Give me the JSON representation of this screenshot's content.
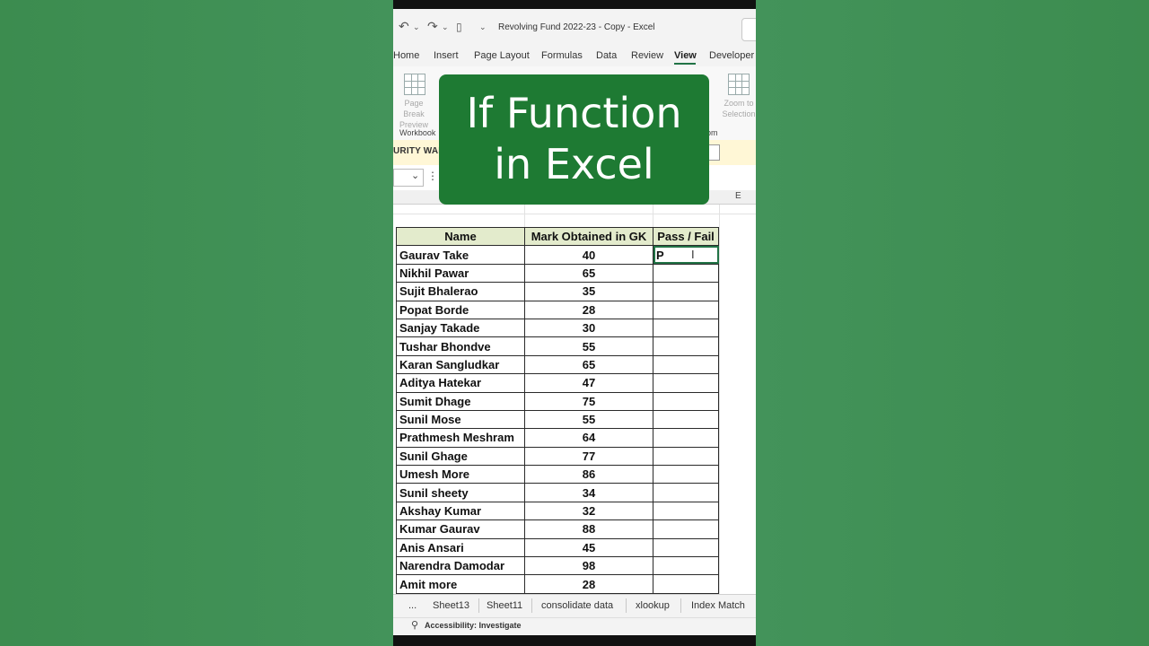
{
  "window": {
    "doc_title": "Revolving Fund 2022-23 - Copy  -  Excel"
  },
  "ribbon_tabs": [
    "Home",
    "Insert",
    "Page Layout",
    "Formulas",
    "Data",
    "Review",
    "View",
    "Developer"
  ],
  "active_tab": "View",
  "ribbon": {
    "page_break_label_1": "Page Break",
    "page_break_label_2": "Preview",
    "zoom_label_1": "Zoom to",
    "zoom_label_2": "Selection",
    "group_workbook": "Workbook",
    "group_zoom": "om"
  },
  "security_bar": {
    "text": "URITY WARN"
  },
  "columns": {
    "e": "E"
  },
  "overlay": {
    "line1": "If Function",
    "line2": "in Excel",
    "color": "#1e7a33"
  },
  "table": {
    "headers": [
      "Name",
      "Mark Obtained in GK",
      "Pass / Fail"
    ],
    "rows": [
      {
        "name": "Gaurav Take",
        "mark": "40",
        "result": "P"
      },
      {
        "name": "Nikhil Pawar",
        "mark": "65",
        "result": ""
      },
      {
        "name": "Sujit Bhalerao",
        "mark": "35",
        "result": ""
      },
      {
        "name": "Popat Borde",
        "mark": "28",
        "result": ""
      },
      {
        "name": "Sanjay Takade",
        "mark": "30",
        "result": ""
      },
      {
        "name": "Tushar Bhondve",
        "mark": "55",
        "result": ""
      },
      {
        "name": "Karan Sangludkar",
        "mark": "65",
        "result": ""
      },
      {
        "name": "Aditya Hatekar",
        "mark": "47",
        "result": ""
      },
      {
        "name": "Sumit Dhage",
        "mark": "75",
        "result": ""
      },
      {
        "name": "Sunil Mose",
        "mark": "55",
        "result": ""
      },
      {
        "name": "Prathmesh Meshram",
        "mark": "64",
        "result": ""
      },
      {
        "name": "Sunil Ghage",
        "mark": "77",
        "result": ""
      },
      {
        "name": "Umesh More",
        "mark": "86",
        "result": ""
      },
      {
        "name": "Sunil sheety",
        "mark": "34",
        "result": ""
      },
      {
        "name": "Akshay Kumar",
        "mark": "32",
        "result": ""
      },
      {
        "name": "Kumar Gaurav",
        "mark": "88",
        "result": ""
      },
      {
        "name": "Anis Ansari",
        "mark": "45",
        "result": ""
      },
      {
        "name": "Narendra Damodar",
        "mark": "98",
        "result": ""
      },
      {
        "name": "Amit more",
        "mark": "28",
        "result": ""
      }
    ]
  },
  "sheet_tabs": [
    "...",
    "Sheet13",
    "Sheet11",
    "consolidate data",
    "xlookup",
    "Index Match"
  ],
  "status": {
    "text": "Accessibility: Investigate"
  }
}
